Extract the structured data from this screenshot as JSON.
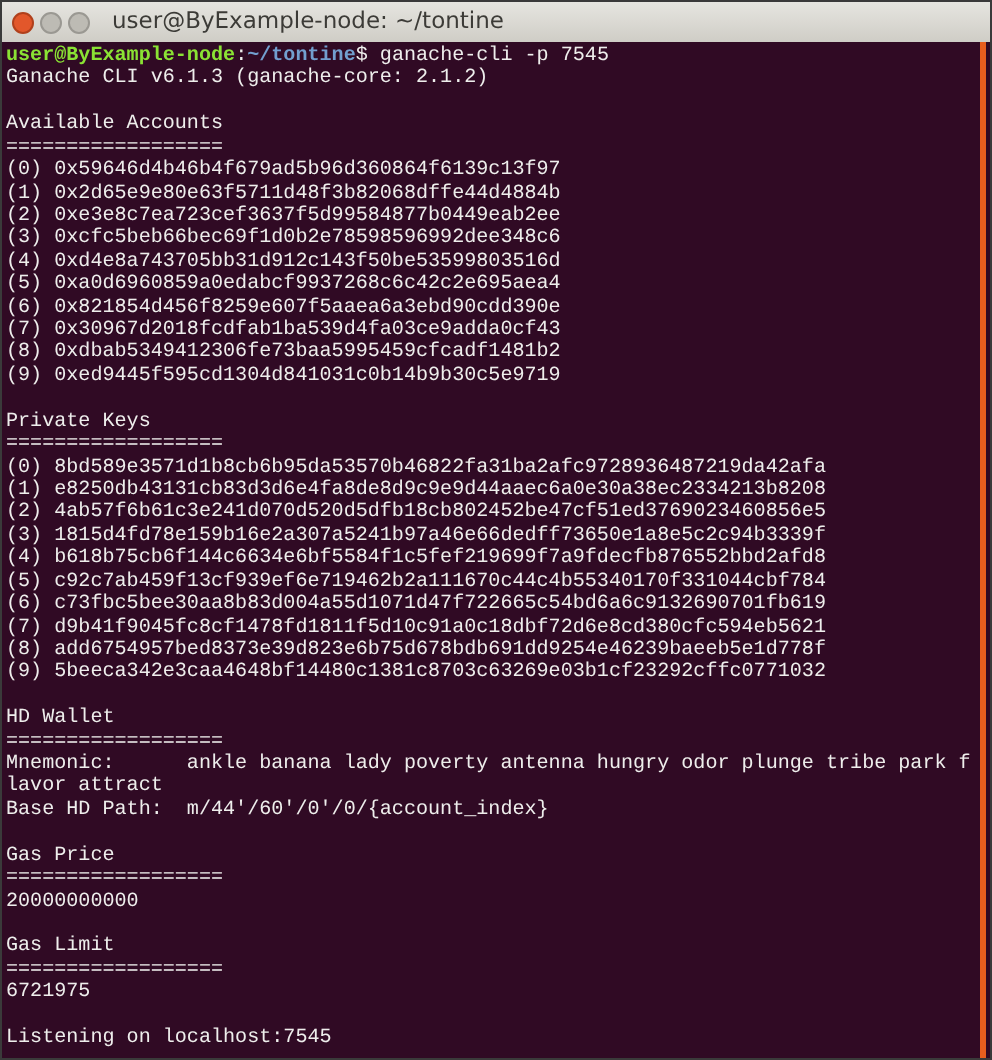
{
  "window": {
    "title": "user@ByExample-node: ~/tontine"
  },
  "prompt": {
    "user_host": "user@ByExample-node",
    "separator": ":",
    "path": "~/tontine",
    "command": "$ ganache-cli -p 7545"
  },
  "version": "Ganache CLI v6.1.3 (ganache-core: 2.1.2)",
  "sections": [
    {
      "title": "Available Accounts",
      "rule": "==================",
      "lines": [
        "(0) 0x59646d4b46b4f679ad5b96d360864f6139c13f97",
        "(1) 0x2d65e9e80e63f5711d48f3b82068dffe44d4884b",
        "(2) 0xe3e8c7ea723cef3637f5d99584877b0449eab2ee",
        "(3) 0xcfc5beb66bec69f1d0b2e78598596992dee348c6",
        "(4) 0xd4e8a743705bb31d912c143f50be53599803516d",
        "(5) 0xa0d6960859a0edabcf9937268c6c42c2e695aea4",
        "(6) 0x821854d456f8259e607f5aaea6a3ebd90cdd390e",
        "(7) 0x30967d2018fcdfab1ba539d4fa03ce9adda0cf43",
        "(8) 0xdbab5349412306fe73baa5995459cfcadf1481b2",
        "(9) 0xed9445f595cd1304d841031c0b14b9b30c5e9719"
      ]
    },
    {
      "title": "Private Keys",
      "rule": "==================",
      "lines": [
        "(0) 8bd589e3571d1b8cb6b95da53570b46822fa31ba2afc9728936487219da42afa",
        "(1) e8250db43131cb83d3d6e4fa8de8d9c9e9d44aaec6a0e30a38ec2334213b8208",
        "(2) 4ab57f6b61c3e241d070d520d5dfb18cb802452be47cf51ed3769023460856e5",
        "(3) 1815d4fd78e159b16e2a307a5241b97a46e66dedff73650e1a8e5c2c94b3339f",
        "(4) b618b75cb6f144c6634e6bf5584f1c5fef219699f7a9fdecfb876552bbd2afd8",
        "(5) c92c7ab459f13cf939ef6e719462b2a111670c44c4b55340170f331044cbf784",
        "(6) c73fbc5bee30aa8b83d004a55d1071d47f722665c54bd6a6c9132690701fb619",
        "(7) d9b41f9045fc8cf1478fd1811f5d10c91a0c18dbf72d6e8cd380cfc594eb5621",
        "(8) add6754957bed8373e39d823e6b75d678bdb691dd9254e46239baeeb5e1d778f",
        "(9) 5beeca342e3caa4648bf14480c1381c8703c63269e03b1cf23292cffc0771032"
      ]
    },
    {
      "title": "HD Wallet",
      "rule": "==================",
      "lines": [
        "Mnemonic:      ankle banana lady poverty antenna hungry odor plunge tribe park flavor attract",
        "Base HD Path:  m/44'/60'/0'/0/{account_index}"
      ]
    },
    {
      "title": "Gas Price",
      "rule": "==================",
      "lines": [
        "20000000000"
      ]
    },
    {
      "title": "Gas Limit",
      "rule": "==================",
      "lines": [
        "6721975"
      ]
    }
  ],
  "listening": "Listening on localhost:7545"
}
